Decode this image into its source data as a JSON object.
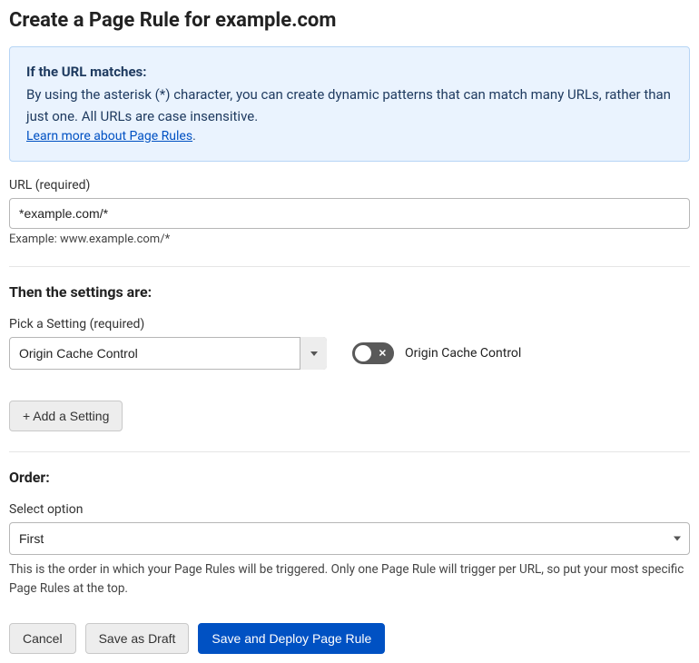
{
  "header": {
    "title": "Create a Page Rule for example.com"
  },
  "info": {
    "title": "If the URL matches:",
    "body": "By using the asterisk (*) character, you can create dynamic patterns that can match many URLs, rather than just one. All URLs are case insensitive.",
    "link_text": "Learn more about Page Rules"
  },
  "url_field": {
    "label": "URL (required)",
    "value": "*example.com/*",
    "example": "Example: www.example.com/*"
  },
  "settings_section": {
    "heading": "Then the settings are:",
    "pick_label": "Pick a Setting (required)",
    "selected": "Origin Cache Control",
    "toggle_label": "Origin Cache Control",
    "add_button": "+ Add a Setting"
  },
  "order_section": {
    "heading": "Order:",
    "select_label": "Select option",
    "selected": "First",
    "description": "This is the order in which your Page Rules will be triggered. Only one Page Rule will trigger per URL, so put your most specific Page Rules at the top."
  },
  "actions": {
    "cancel": "Cancel",
    "save_draft": "Save as Draft",
    "save_deploy": "Save and Deploy Page Rule"
  }
}
